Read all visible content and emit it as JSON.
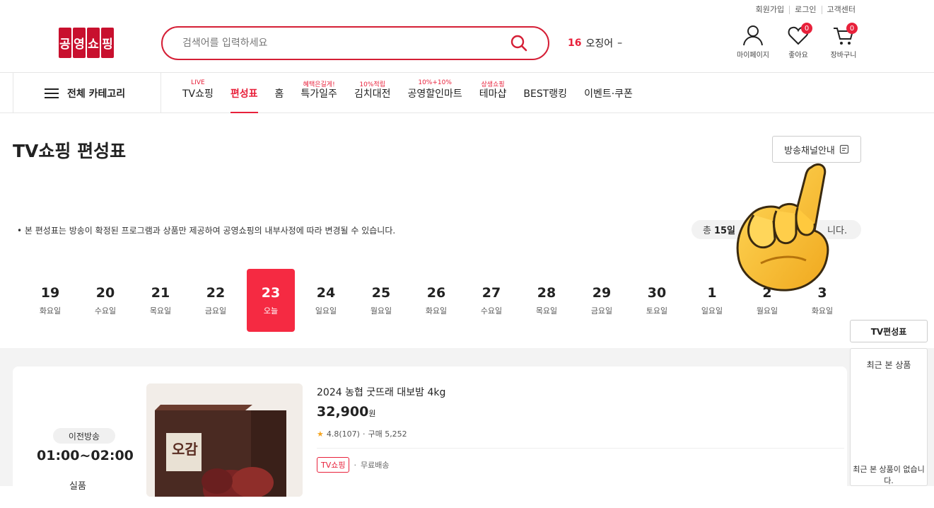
{
  "utility_links": [
    "회원가입",
    "로그인",
    "고객센터"
  ],
  "logo_text": [
    "공",
    "영",
    "쇼",
    "핑"
  ],
  "search": {
    "placeholder": "검색어를 입력하세요"
  },
  "trending": {
    "rank": "16",
    "keyword": "오징어",
    "change": "–"
  },
  "header_icons": [
    {
      "icon": "user-icon",
      "label": "마이페이지"
    },
    {
      "icon": "heart-icon",
      "label": "좋아요",
      "badge": "0"
    },
    {
      "icon": "cart-icon",
      "label": "장바구니",
      "badge": "0"
    }
  ],
  "gnb": {
    "all_category": "전체 카테고리",
    "items": [
      {
        "label": "TV쇼핑",
        "tag": "LIVE"
      },
      {
        "label": "편성표",
        "tag": "",
        "active": true
      },
      {
        "label": "홈",
        "tag": ""
      },
      {
        "label": "특가일주",
        "tag": "혜택은길게!"
      },
      {
        "label": "김치대전",
        "tag": "10%적립"
      },
      {
        "label": "공영할인마트",
        "tag": "10%+10%"
      },
      {
        "label": "테마샵",
        "tag": "상생쇼핑"
      },
      {
        "label": "BEST랭킹",
        "tag": ""
      },
      {
        "label": "이벤트·쿠폰",
        "tag": ""
      }
    ]
  },
  "page": {
    "title": "TV쇼핑 편성표",
    "channel_button": "방송채널안내",
    "notice": "• 본 편성표는 방송이 확정된 프로그램과 상품만 제공하여 공영쇼핑의 내부사정에 따라 변경될 수 있습니다.",
    "total_prefix": "총",
    "total_count": "15일",
    "total_suffix": "니다."
  },
  "dates": [
    {
      "day": "19",
      "weekday": "화요일"
    },
    {
      "day": "20",
      "weekday": "수요일"
    },
    {
      "day": "21",
      "weekday": "목요일"
    },
    {
      "day": "22",
      "weekday": "금요일"
    },
    {
      "day": "23",
      "weekday": "오늘",
      "selected": true
    },
    {
      "day": "24",
      "weekday": "일요일"
    },
    {
      "day": "25",
      "weekday": "월요일"
    },
    {
      "day": "26",
      "weekday": "화요일"
    },
    {
      "day": "27",
      "weekday": "수요일"
    },
    {
      "day": "28",
      "weekday": "목요일"
    },
    {
      "day": "29",
      "weekday": "금요일"
    },
    {
      "day": "30",
      "weekday": "토요일"
    },
    {
      "day": "1",
      "weekday": "일요일"
    },
    {
      "day": "2",
      "weekday": "월요일"
    },
    {
      "day": "3",
      "weekday": "화요일"
    }
  ],
  "broadcast": {
    "status": "이전방송",
    "time": "01:00~02:00",
    "type": "실품",
    "product_name": "2024 농협 굿뜨래 대보밤 4kg",
    "price": "32,900",
    "price_unit": "원",
    "rating": "4.8(107)",
    "purchases": "구매 5,252",
    "tag": "TV쇼핑",
    "shipping": "무료배송",
    "image_text": "오감"
  },
  "side": {
    "tv_button": "TV편성표",
    "recent_title": "최근 본 상품",
    "recent_empty": "최근 본 상품이 없습니다."
  },
  "colors": {
    "brand": "#e8213b",
    "logo": "#c8102e"
  }
}
